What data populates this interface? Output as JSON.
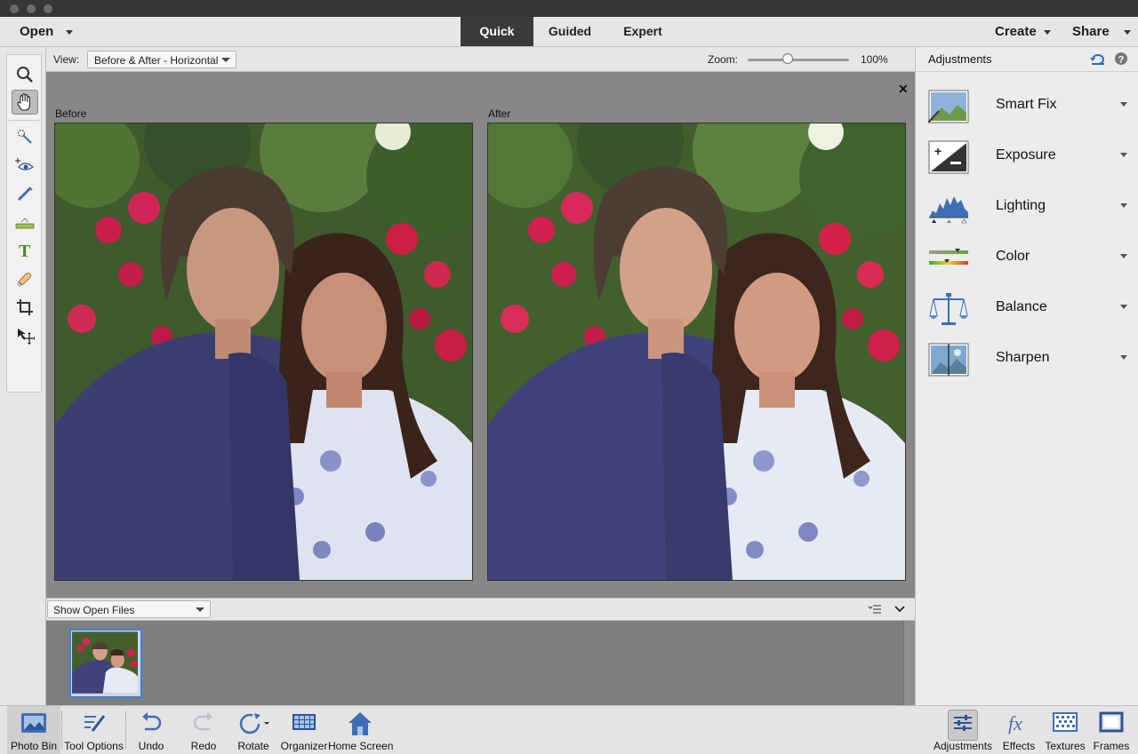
{
  "menubar": {
    "open_label": "Open",
    "modes": [
      "Quick",
      "Guided",
      "Expert"
    ],
    "active_mode": "Quick",
    "create_label": "Create",
    "share_label": "Share"
  },
  "toolbar": {
    "tools": [
      "zoom-tool",
      "hand-tool",
      "quick-selection-tool",
      "red-eye-tool",
      "whiten-teeth-tool",
      "straighten-tool",
      "type-tool",
      "spot-healing-tool",
      "crop-tool",
      "move-tool"
    ],
    "active_tool": "hand-tool"
  },
  "viewbar": {
    "view_label": "View:",
    "view_value": "Before & After - Horizontal",
    "zoom_label": "Zoom:",
    "zoom_value": "100%",
    "zoom_level": 0.38
  },
  "canvas": {
    "before_label": "Before",
    "after_label": "After"
  },
  "photobin": {
    "dropdown_value": "Show Open Files"
  },
  "panel": {
    "title": "Adjustments",
    "items": [
      {
        "label": "Smart Fix",
        "icon": "smart-fix-icon"
      },
      {
        "label": "Exposure",
        "icon": "exposure-icon"
      },
      {
        "label": "Lighting",
        "icon": "lighting-icon"
      },
      {
        "label": "Color",
        "icon": "color-icon"
      },
      {
        "label": "Balance",
        "icon": "balance-icon"
      },
      {
        "label": "Sharpen",
        "icon": "sharpen-icon"
      }
    ]
  },
  "bottombar": {
    "photo_bin": "Photo Bin",
    "tool_options": "Tool Options",
    "undo": "Undo",
    "redo": "Redo",
    "rotate": "Rotate",
    "organizer": "Organizer",
    "home_screen": "Home Screen",
    "adjustments": "Adjustments",
    "effects": "Effects",
    "textures": "Textures",
    "frames": "Frames"
  },
  "colors": {
    "active_tab_bg": "#3a3a3a",
    "selection_blue": "#3d7fd9",
    "icon_blue": "#3e6fb6"
  }
}
